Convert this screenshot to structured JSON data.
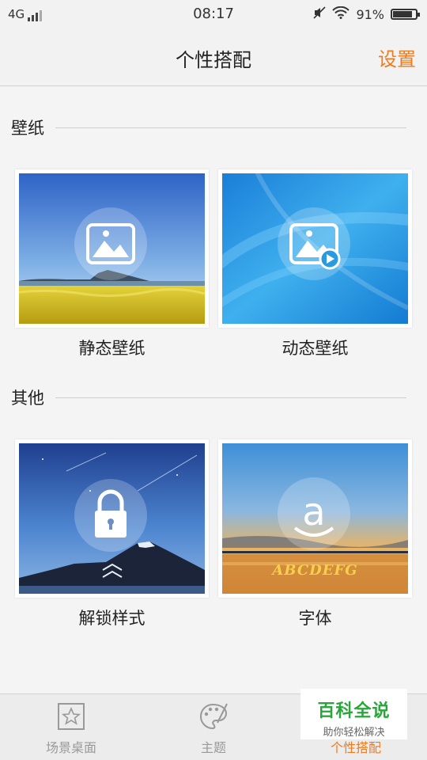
{
  "status_bar": {
    "network": "4G",
    "time": "08:17",
    "battery_percent": "91%",
    "battery_level": 0.91
  },
  "header": {
    "title": "个性搭配",
    "settings_label": "设置"
  },
  "sections": [
    {
      "label": "壁纸",
      "tiles": [
        {
          "label": "静态壁纸",
          "icon": "image-icon"
        },
        {
          "label": "动态壁纸",
          "icon": "video-image-icon"
        }
      ]
    },
    {
      "label": "其他",
      "tiles": [
        {
          "label": "解锁样式",
          "icon": "lock-icon"
        },
        {
          "label": "字体",
          "icon": "font-icon",
          "sample_text": "ABCDEFG"
        }
      ]
    }
  ],
  "bottom_nav": {
    "items": [
      {
        "label": "场景桌面",
        "icon": "star-frame-icon"
      },
      {
        "label": "主题",
        "icon": "palette-icon"
      },
      {
        "label": "个性搭配",
        "icon": "personalize-icon",
        "active": true
      }
    ]
  },
  "watermark": {
    "title": "百科全说",
    "subtitle": "助你轻松解决"
  },
  "colors": {
    "accent": "#f07a1e",
    "background": "#f4f4f4",
    "watermark_green": "#2aa53a"
  }
}
